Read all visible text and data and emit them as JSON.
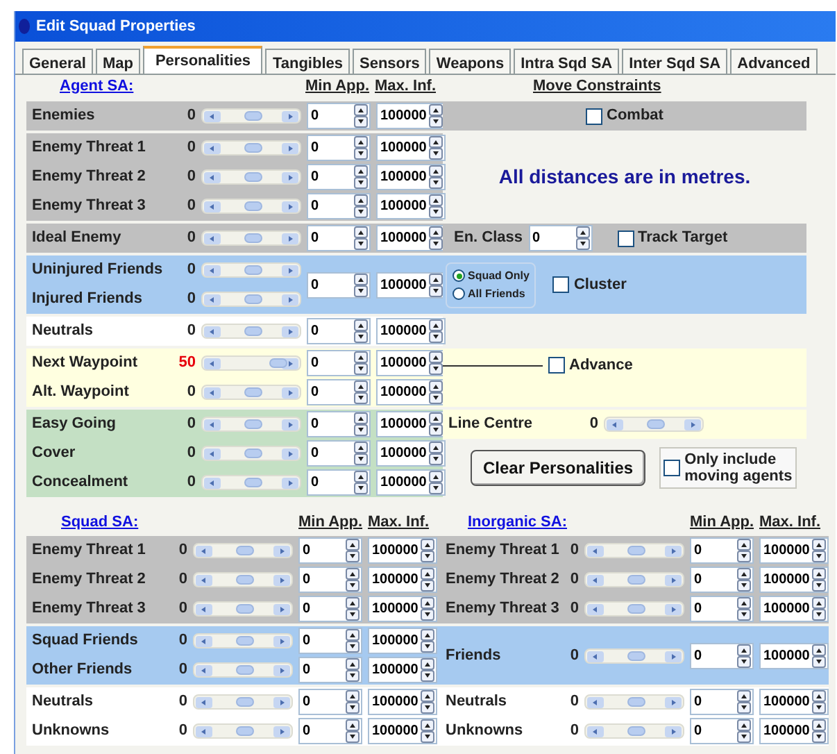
{
  "window": {
    "title": "Edit Squad Properties"
  },
  "tabs": [
    {
      "label": "General",
      "selected": false
    },
    {
      "label": "Map",
      "selected": false
    },
    {
      "label": "Personalities",
      "selected": true
    },
    {
      "label": "Tangibles",
      "selected": false
    },
    {
      "label": "Sensors",
      "selected": false
    },
    {
      "label": "Weapons",
      "selected": false
    },
    {
      "label": "Intra Sqd SA",
      "selected": false
    },
    {
      "label": "Inter Sqd SA",
      "selected": false
    },
    {
      "label": "Advanced",
      "selected": false
    }
  ],
  "agent_sa": {
    "title": "Agent SA:",
    "min_app_header": "Min App.",
    "max_inf_header": "Max. Inf.",
    "move_header": "Move Constraints",
    "groups": [
      {
        "color": "#c0c0c0",
        "rows": [
          {
            "label": "Enemies",
            "value": "0",
            "modified": false,
            "level": 0.5,
            "min_app": "0",
            "max_inf": "100000"
          }
        ],
        "side": {
          "kind": "checkbox",
          "color": "#c0c0c0",
          "checkbox": {
            "label": "Combat",
            "checked": false
          }
        }
      },
      {
        "color": "#c0c0c0",
        "rows": [
          {
            "label": "Enemy Threat 1",
            "value": "0",
            "modified": false,
            "level": 0.5,
            "min_app": "0",
            "max_inf": "100000"
          },
          {
            "label": "Enemy Threat 2",
            "value": "0",
            "modified": false,
            "level": 0.5,
            "min_app": "0",
            "max_inf": "100000"
          },
          {
            "label": "Enemy Threat 3",
            "value": "0",
            "modified": false,
            "level": 0.5,
            "min_app": "0",
            "max_inf": "100000"
          }
        ],
        "side": {
          "kind": "message",
          "text": "All distances are in metres."
        }
      },
      {
        "color": "#c0c0c0",
        "rows": [
          {
            "label": "Ideal Enemy",
            "value": "0",
            "modified": false,
            "level": 0.5,
            "min_app": "0",
            "max_inf": "100000"
          }
        ],
        "side": {
          "kind": "class",
          "color": "#c0c0c0",
          "label": "En. Class",
          "value": "0",
          "checkbox": {
            "label": "Track Target",
            "checked": false
          }
        }
      },
      {
        "color": "#a6caf0",
        "shared": {
          "min_app": "0",
          "max_inf": "100000"
        },
        "rows": [
          {
            "label": "Uninjured Friends",
            "value": "0",
            "modified": false,
            "level": 0.5
          },
          {
            "label": "Injured Friends",
            "value": "0",
            "modified": false,
            "level": 0.5
          }
        ],
        "side": {
          "kind": "scope",
          "color": "#a6caf0",
          "options": [
            {
              "label": "Squad Only",
              "selected": true
            },
            {
              "label": "All Friends",
              "selected": false
            }
          ],
          "checkbox": {
            "label": "Cluster",
            "checked": false
          }
        }
      },
      {
        "color": "#ffffff",
        "rows": [
          {
            "label": "Neutrals",
            "value": "0",
            "modified": false,
            "level": 0.5,
            "min_app": "0",
            "max_inf": "100000"
          }
        ],
        "side": {
          "kind": "empty"
        }
      },
      {
        "color": "#ffffe0",
        "rows": [
          {
            "label": "Next Waypoint",
            "value": "50",
            "modified": true,
            "level": 0.75,
            "min_app": "0",
            "max_inf": "100000"
          },
          {
            "label": "Alt. Waypoint",
            "value": "0",
            "modified": false,
            "level": 0.5,
            "min_app": "0",
            "max_inf": "100000"
          }
        ],
        "side": {
          "kind": "advance",
          "color": "#ffffe0",
          "checkbox": {
            "label": "Advance",
            "checked": false
          }
        }
      },
      {
        "color": "#c4e0c4",
        "rows": [
          {
            "label": "Easy Going",
            "value": "0",
            "modified": false,
            "level": 0.5,
            "min_app": "0",
            "max_inf": "100000"
          },
          {
            "label": "Cover",
            "value": "0",
            "modified": false,
            "level": 0.5,
            "min_app": "0",
            "max_inf": "100000"
          },
          {
            "label": "Concealment",
            "value": "0",
            "modified": false,
            "level": 0.5,
            "min_app": "0",
            "max_inf": "100000"
          }
        ],
        "side": {
          "kind": "actions",
          "slider": {
            "label": "Line Centre",
            "value": "0",
            "level": 0.5,
            "color": "#ffffe0"
          },
          "button": "Clear Personalities",
          "checkbox": {
            "label": "Only include moving agents",
            "checked": false
          }
        }
      }
    ]
  },
  "squad_sa": {
    "title": "Squad SA:",
    "min_app_header": "Min App.",
    "max_inf_header": "Max. Inf.",
    "groups": [
      {
        "color": "#c0c0c0",
        "rows": [
          {
            "label": "Enemy Threat 1",
            "value": "0",
            "modified": false,
            "level": 0.5,
            "min_app": "0",
            "max_inf": "100000"
          },
          {
            "label": "Enemy Threat 2",
            "value": "0",
            "modified": false,
            "level": 0.5,
            "min_app": "0",
            "max_inf": "100000"
          },
          {
            "label": "Enemy Threat 3",
            "value": "0",
            "modified": false,
            "level": 0.5,
            "min_app": "0",
            "max_inf": "100000"
          }
        ]
      },
      {
        "color": "#a6caf0",
        "rows": [
          {
            "label": "Squad Friends",
            "value": "0",
            "modified": false,
            "level": 0.5,
            "min_app": "0",
            "max_inf": "100000"
          },
          {
            "label": "Other Friends",
            "value": "0",
            "modified": false,
            "level": 0.5,
            "min_app": "0",
            "max_inf": "100000"
          }
        ]
      },
      {
        "color": "#ffffff",
        "rows": [
          {
            "label": "Neutrals",
            "value": "0",
            "modified": false,
            "level": 0.5,
            "min_app": "0",
            "max_inf": "100000"
          },
          {
            "label": "Unknowns",
            "value": "0",
            "modified": false,
            "level": 0.5,
            "min_app": "0",
            "max_inf": "100000"
          }
        ]
      }
    ]
  },
  "inorganic_sa": {
    "title": "Inorganic SA:",
    "min_app_header": "Min App.",
    "max_inf_header": "Max. Inf.",
    "groups": [
      {
        "color": "#c0c0c0",
        "rows": [
          {
            "label": "Enemy Threat 1",
            "value": "0",
            "modified": false,
            "level": 0.5,
            "min_app": "0",
            "max_inf": "100000"
          },
          {
            "label": "Enemy Threat 2",
            "value": "0",
            "modified": false,
            "level": 0.5,
            "min_app": "0",
            "max_inf": "100000"
          },
          {
            "label": "Enemy Threat 3",
            "value": "0",
            "modified": false,
            "level": 0.5,
            "min_app": "0",
            "max_inf": "100000"
          }
        ]
      },
      {
        "color": "#a6caf0",
        "rows": [
          {
            "label": "Friends",
            "value": "0",
            "modified": false,
            "level": 0.5,
            "min_app": "0",
            "max_inf": "100000"
          }
        ]
      },
      {
        "color": "#ffffff",
        "rows": [
          {
            "label": "Neutrals",
            "value": "0",
            "modified": false,
            "level": 0.5,
            "min_app": "0",
            "max_inf": "100000"
          },
          {
            "label": "Unknowns",
            "value": "0",
            "modified": false,
            "level": 0.5,
            "min_app": "0",
            "max_inf": "100000"
          }
        ]
      }
    ]
  }
}
